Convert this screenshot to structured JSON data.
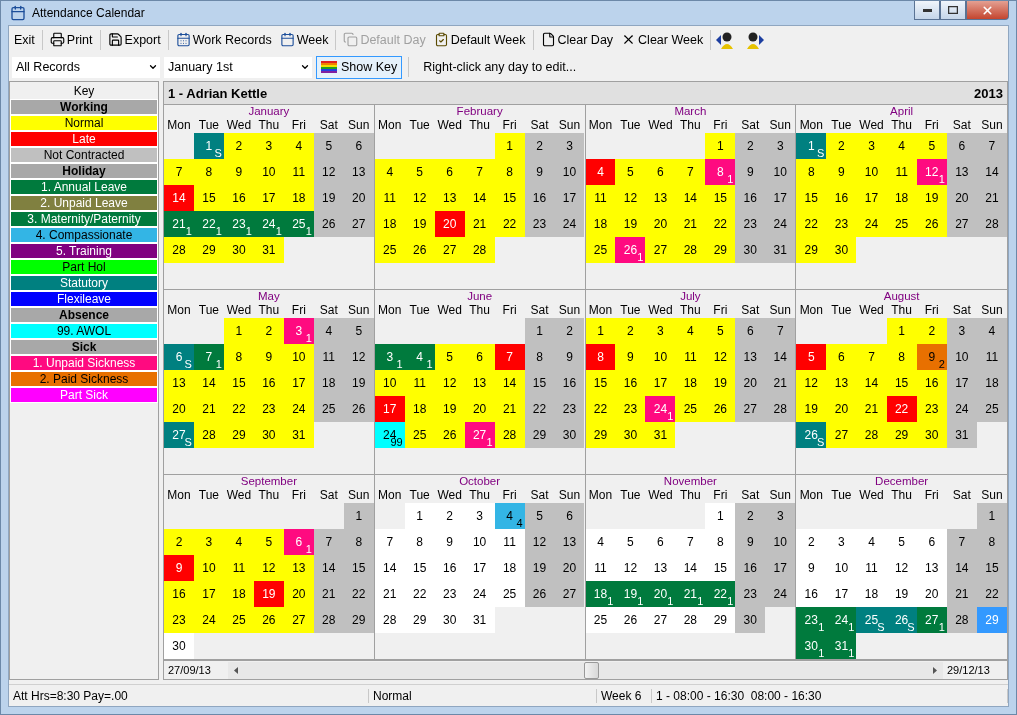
{
  "window": {
    "title": "Attendance Calendar"
  },
  "toolbar": [
    {
      "label": "Exit",
      "kind": "exit",
      "disabled": false
    },
    {
      "label": "Print",
      "kind": "print",
      "disabled": false
    },
    {
      "label": "Export",
      "kind": "export",
      "disabled": false
    },
    {
      "label": "Work Records",
      "kind": "records",
      "disabled": false
    },
    {
      "label": "Week",
      "kind": "week",
      "disabled": false
    },
    {
      "label": "Default Day",
      "kind": "default_day",
      "disabled": true
    },
    {
      "label": "Default Week",
      "kind": "default_week",
      "disabled": false
    },
    {
      "label": "Clear Day",
      "kind": "clear_day",
      "disabled": false
    },
    {
      "label": "Clear Week",
      "kind": "clear_week",
      "disabled": false
    }
  ],
  "filters": {
    "record": "All Records",
    "date": "January 1st"
  },
  "show_key": {
    "label": "Show Key",
    "pressed": true
  },
  "hint": "Right-click any day to edit...",
  "key": {
    "title": "Key",
    "items": [
      {
        "label": "Working",
        "kind": "group"
      },
      {
        "label": "Normal",
        "kind": "entry",
        "color": "#ffff00"
      },
      {
        "label": "Late",
        "kind": "entry",
        "color": "#ff0000"
      },
      {
        "label": "Not Contracted",
        "kind": "entry",
        "color": "#c0c0c0"
      },
      {
        "label": "Holiday",
        "kind": "group"
      },
      {
        "label": "1. Annual Leave",
        "kind": "entry",
        "color": "#007a3d"
      },
      {
        "label": "2. Unpaid Leave",
        "kind": "entry",
        "color": "#808040"
      },
      {
        "label": "3. Maternity/Paternity",
        "kind": "entry",
        "color": "#007a3d"
      },
      {
        "label": "4. Compassionate",
        "kind": "entry",
        "color": "#33b5e5"
      },
      {
        "label": "5. Training",
        "kind": "entry",
        "color": "#800080"
      },
      {
        "label": "Part Hol",
        "kind": "entry",
        "color": "#00ff00"
      },
      {
        "label": "Statutory",
        "kind": "entry",
        "color": "#008080"
      },
      {
        "label": "Flexileave",
        "kind": "entry",
        "color": "#0000ff"
      },
      {
        "label": "Absence",
        "kind": "group"
      },
      {
        "label": "99. AWOL",
        "kind": "entry",
        "color": "#00ffff"
      },
      {
        "label": "Sick",
        "kind": "group"
      },
      {
        "label": "1. Unpaid Sickness",
        "kind": "entry",
        "color": "#ff0a80"
      },
      {
        "label": "2. Paid Sickness",
        "kind": "entry",
        "color": "#e87000"
      },
      {
        "label": "Part Sick",
        "kind": "entry",
        "color": "#ff00ff"
      }
    ]
  },
  "calendar": {
    "employee": "1 - Adrian Kettle",
    "year": "2013",
    "months": [
      {
        "name": "January",
        "weekdays": [
          "Mon",
          "Tue",
          "Wed",
          "Thu",
          "Fri",
          "Sat",
          "Sun"
        ],
        "weeks": [
          [
            {
              "day": "1",
              "kind": "statutory",
              "note": "S"
            },
            {
              "day": "2",
              "kind": "work"
            },
            {
              "day": "3",
              "kind": "work"
            },
            {
              "day": "4",
              "kind": "work"
            },
            {
              "day": "5",
              "kind": "off"
            },
            {
              "day": "6",
              "kind": "off"
            }
          ],
          [
            {
              "day": "7",
              "kind": "work"
            },
            {
              "day": "8",
              "kind": "work"
            },
            {
              "day": "9",
              "kind": "work"
            },
            {
              "day": "10",
              "kind": "work"
            },
            {
              "day": "11",
              "kind": "work"
            },
            {
              "day": "12",
              "kind": "off"
            },
            {
              "day": "13",
              "kind": "off"
            }
          ],
          [
            {
              "day": "14",
              "kind": "late"
            },
            {
              "day": "15",
              "kind": "work"
            },
            {
              "day": "16",
              "kind": "work"
            },
            {
              "day": "17",
              "kind": "work"
            },
            {
              "day": "18",
              "kind": "work"
            },
            {
              "day": "19",
              "kind": "off"
            },
            {
              "day": "20",
              "kind": "off"
            }
          ],
          [
            {
              "day": "21",
              "kind": "annual",
              "note": "1"
            },
            {
              "day": "22",
              "kind": "annual",
              "note": "1"
            },
            {
              "day": "23",
              "kind": "annual",
              "note": "1"
            },
            {
              "day": "24",
              "kind": "annual",
              "note": "1"
            },
            {
              "day": "25",
              "kind": "annual",
              "note": "1"
            },
            {
              "day": "26",
              "kind": "off"
            },
            {
              "day": "27",
              "kind": "off"
            }
          ],
          [
            {
              "day": "28",
              "kind": "work"
            },
            {
              "day": "29",
              "kind": "work"
            },
            {
              "day": "30",
              "kind": "work"
            },
            {
              "day": "31",
              "kind": "work"
            }
          ]
        ]
      },
      {
        "name": "February",
        "weekdays": [
          "Mon",
          "Tue",
          "Wed",
          "Thu",
          "Fri",
          "Sat",
          "Sun"
        ],
        "weeks": [
          [
            {
              "day": "1",
              "kind": "work"
            },
            {
              "day": "2",
              "kind": "off"
            },
            {
              "day": "3",
              "kind": "off"
            }
          ],
          [
            {
              "day": "4",
              "kind": "work"
            },
            {
              "day": "5",
              "kind": "work"
            },
            {
              "day": "6",
              "kind": "work"
            },
            {
              "day": "7",
              "kind": "work"
            },
            {
              "day": "8",
              "kind": "work"
            },
            {
              "day": "9",
              "kind": "off"
            },
            {
              "day": "10",
              "kind": "off"
            }
          ],
          [
            {
              "day": "11",
              "kind": "work"
            },
            {
              "day": "12",
              "kind": "work"
            },
            {
              "day": "13",
              "kind": "work"
            },
            {
              "day": "14",
              "kind": "work"
            },
            {
              "day": "15",
              "kind": "work"
            },
            {
              "day": "16",
              "kind": "off"
            },
            {
              "day": "17",
              "kind": "off"
            }
          ],
          [
            {
              "day": "18",
              "kind": "work"
            },
            {
              "day": "19",
              "kind": "work"
            },
            {
              "day": "20",
              "kind": "late"
            },
            {
              "day": "21",
              "kind": "work"
            },
            {
              "day": "22",
              "kind": "work"
            },
            {
              "day": "23",
              "kind": "off"
            },
            {
              "day": "24",
              "kind": "off"
            }
          ],
          [
            {
              "day": "25",
              "kind": "work"
            },
            {
              "day": "26",
              "kind": "work"
            },
            {
              "day": "27",
              "kind": "work"
            },
            {
              "day": "28",
              "kind": "work"
            }
          ]
        ]
      },
      {
        "name": "March",
        "weekdays": [
          "Mon",
          "Tue",
          "Wed",
          "Thu",
          "Fri",
          "Sat",
          "Sun"
        ],
        "weeks": [
          [
            {
              "day": "1",
              "kind": "work"
            },
            {
              "day": "2",
              "kind": "off"
            },
            {
              "day": "3",
              "kind": "off"
            }
          ],
          [
            {
              "day": "4",
              "kind": "late"
            },
            {
              "day": "5",
              "kind": "work"
            },
            {
              "day": "6",
              "kind": "work"
            },
            {
              "day": "7",
              "kind": "work"
            },
            {
              "day": "8",
              "kind": "sick_unpaid",
              "note": "1"
            },
            {
              "day": "9",
              "kind": "off"
            },
            {
              "day": "10",
              "kind": "off"
            }
          ],
          [
            {
              "day": "11",
              "kind": "work"
            },
            {
              "day": "12",
              "kind": "work"
            },
            {
              "day": "13",
              "kind": "work"
            },
            {
              "day": "14",
              "kind": "work"
            },
            {
              "day": "15",
              "kind": "work"
            },
            {
              "day": "16",
              "kind": "off"
            },
            {
              "day": "17",
              "kind": "off"
            }
          ],
          [
            {
              "day": "18",
              "kind": "work"
            },
            {
              "day": "19",
              "kind": "work"
            },
            {
              "day": "20",
              "kind": "work"
            },
            {
              "day": "21",
              "kind": "work"
            },
            {
              "day": "22",
              "kind": "work"
            },
            {
              "day": "23",
              "kind": "off"
            },
            {
              "day": "24",
              "kind": "off"
            }
          ],
          [
            {
              "day": "25",
              "kind": "work"
            },
            {
              "day": "26",
              "kind": "sick_unpaid",
              "note": "1"
            },
            {
              "day": "27",
              "kind": "work"
            },
            {
              "day": "28",
              "kind": "work"
            },
            {
              "day": "29",
              "kind": "work"
            },
            {
              "day": "30",
              "kind": "off"
            },
            {
              "day": "31",
              "kind": "off"
            }
          ]
        ]
      },
      {
        "name": "April",
        "weekdays": [
          "Mon",
          "Tue",
          "Wed",
          "Thu",
          "Fri",
          "Sat",
          "Sun"
        ],
        "weeks": [
          [
            {
              "day": "1",
              "kind": "statutory",
              "note": "S"
            },
            {
              "day": "2",
              "kind": "work"
            },
            {
              "day": "3",
              "kind": "work"
            },
            {
              "day": "4",
              "kind": "work"
            },
            {
              "day": "5",
              "kind": "work"
            },
            {
              "day": "6",
              "kind": "off"
            },
            {
              "day": "7",
              "kind": "off"
            }
          ],
          [
            {
              "day": "8",
              "kind": "work"
            },
            {
              "day": "9",
              "kind": "work"
            },
            {
              "day": "10",
              "kind": "work"
            },
            {
              "day": "11",
              "kind": "work"
            },
            {
              "day": "12",
              "kind": "sick_unpaid",
              "note": "1"
            },
            {
              "day": "13",
              "kind": "off"
            },
            {
              "day": "14",
              "kind": "off"
            }
          ],
          [
            {
              "day": "15",
              "kind": "work"
            },
            {
              "day": "16",
              "kind": "work"
            },
            {
              "day": "17",
              "kind": "work"
            },
            {
              "day": "18",
              "kind": "work"
            },
            {
              "day": "19",
              "kind": "work"
            },
            {
              "day": "20",
              "kind": "off"
            },
            {
              "day": "21",
              "kind": "off"
            }
          ],
          [
            {
              "day": "22",
              "kind": "work"
            },
            {
              "day": "23",
              "kind": "work"
            },
            {
              "day": "24",
              "kind": "work"
            },
            {
              "day": "25",
              "kind": "work"
            },
            {
              "day": "26",
              "kind": "work"
            },
            {
              "day": "27",
              "kind": "off"
            },
            {
              "day": "28",
              "kind": "off"
            }
          ],
          [
            {
              "day": "29",
              "kind": "work"
            },
            {
              "day": "30",
              "kind": "work"
            }
          ]
        ]
      },
      {
        "name": "May",
        "weekdays": [
          "Mon",
          "Tue",
          "Wed",
          "Thu",
          "Fri",
          "Sat",
          "Sun"
        ],
        "weeks": [
          [
            {
              "day": "1",
              "kind": "work"
            },
            {
              "day": "2",
              "kind": "work"
            },
            {
              "day": "3",
              "kind": "sick_unpaid",
              "note": "1"
            },
            {
              "day": "4",
              "kind": "off"
            },
            {
              "day": "5",
              "kind": "off"
            }
          ],
          [
            {
              "day": "6",
              "kind": "statutory",
              "note": "S"
            },
            {
              "day": "7",
              "kind": "annual",
              "note": "1"
            },
            {
              "day": "8",
              "kind": "work"
            },
            {
              "day": "9",
              "kind": "work"
            },
            {
              "day": "10",
              "kind": "work"
            },
            {
              "day": "11",
              "kind": "off"
            },
            {
              "day": "12",
              "kind": "off"
            }
          ],
          [
            {
              "day": "13",
              "kind": "work"
            },
            {
              "day": "14",
              "kind": "work"
            },
            {
              "day": "15",
              "kind": "work"
            },
            {
              "day": "16",
              "kind": "work"
            },
            {
              "day": "17",
              "kind": "work"
            },
            {
              "day": "18",
              "kind": "off"
            },
            {
              "day": "19",
              "kind": "off"
            }
          ],
          [
            {
              "day": "20",
              "kind": "work"
            },
            {
              "day": "21",
              "kind": "work"
            },
            {
              "day": "22",
              "kind": "work"
            },
            {
              "day": "23",
              "kind": "work"
            },
            {
              "day": "24",
              "kind": "work"
            },
            {
              "day": "25",
              "kind": "off"
            },
            {
              "day": "26",
              "kind": "off"
            }
          ],
          [
            {
              "day": "27",
              "kind": "statutory",
              "note": "S"
            },
            {
              "day": "28",
              "kind": "work"
            },
            {
              "day": "29",
              "kind": "work"
            },
            {
              "day": "30",
              "kind": "work"
            },
            {
              "day": "31",
              "kind": "work"
            }
          ]
        ]
      },
      {
        "name": "June",
        "weekdays": [
          "Mon",
          "Tue",
          "Wed",
          "Thu",
          "Fri",
          "Sat",
          "Sun"
        ],
        "weeks": [
          [
            {
              "day": "1",
              "kind": "off"
            },
            {
              "day": "2",
              "kind": "off"
            }
          ],
          [
            {
              "day": "3",
              "kind": "annual",
              "note": "1"
            },
            {
              "day": "4",
              "kind": "annual",
              "note": "1"
            },
            {
              "day": "5",
              "kind": "work"
            },
            {
              "day": "6",
              "kind": "work"
            },
            {
              "day": "7",
              "kind": "late"
            },
            {
              "day": "8",
              "kind": "off"
            },
            {
              "day": "9",
              "kind": "off"
            }
          ],
          [
            {
              "day": "10",
              "kind": "work"
            },
            {
              "day": "11",
              "kind": "work"
            },
            {
              "day": "12",
              "kind": "work"
            },
            {
              "day": "13",
              "kind": "work"
            },
            {
              "day": "14",
              "kind": "work"
            },
            {
              "day": "15",
              "kind": "off"
            },
            {
              "day": "16",
              "kind": "off"
            }
          ],
          [
            {
              "day": "17",
              "kind": "late"
            },
            {
              "day": "18",
              "kind": "work"
            },
            {
              "day": "19",
              "kind": "work"
            },
            {
              "day": "20",
              "kind": "work"
            },
            {
              "day": "21",
              "kind": "work"
            },
            {
              "day": "22",
              "kind": "off"
            },
            {
              "day": "23",
              "kind": "off"
            }
          ],
          [
            {
              "day": "24",
              "kind": "awol",
              "note": "99"
            },
            {
              "day": "25",
              "kind": "work"
            },
            {
              "day": "26",
              "kind": "work"
            },
            {
              "day": "27",
              "kind": "sick_unpaid",
              "note": "1"
            },
            {
              "day": "28",
              "kind": "work"
            },
            {
              "day": "29",
              "kind": "off"
            },
            {
              "day": "30",
              "kind": "off"
            }
          ]
        ]
      },
      {
        "name": "July",
        "weekdays": [
          "Mon",
          "Tue",
          "Wed",
          "Thu",
          "Fri",
          "Sat",
          "Sun"
        ],
        "weeks": [
          [
            {
              "day": "1",
              "kind": "work"
            },
            {
              "day": "2",
              "kind": "work"
            },
            {
              "day": "3",
              "kind": "work"
            },
            {
              "day": "4",
              "kind": "work"
            },
            {
              "day": "5",
              "kind": "work"
            },
            {
              "day": "6",
              "kind": "off"
            },
            {
              "day": "7",
              "kind": "off"
            }
          ],
          [
            {
              "day": "8",
              "kind": "late"
            },
            {
              "day": "9",
              "kind": "work"
            },
            {
              "day": "10",
              "kind": "work"
            },
            {
              "day": "11",
              "kind": "work"
            },
            {
              "day": "12",
              "kind": "work"
            },
            {
              "day": "13",
              "kind": "off"
            },
            {
              "day": "14",
              "kind": "off"
            }
          ],
          [
            {
              "day": "15",
              "kind": "work"
            },
            {
              "day": "16",
              "kind": "work"
            },
            {
              "day": "17",
              "kind": "work"
            },
            {
              "day": "18",
              "kind": "work"
            },
            {
              "day": "19",
              "kind": "work"
            },
            {
              "day": "20",
              "kind": "off"
            },
            {
              "day": "21",
              "kind": "off"
            }
          ],
          [
            {
              "day": "22",
              "kind": "work"
            },
            {
              "day": "23",
              "kind": "work"
            },
            {
              "day": "24",
              "kind": "sick_unpaid",
              "note": "1"
            },
            {
              "day": "25",
              "kind": "work"
            },
            {
              "day": "26",
              "kind": "work"
            },
            {
              "day": "27",
              "kind": "off"
            },
            {
              "day": "28",
              "kind": "off"
            }
          ],
          [
            {
              "day": "29",
              "kind": "work"
            },
            {
              "day": "30",
              "kind": "work"
            },
            {
              "day": "31",
              "kind": "work"
            }
          ]
        ]
      },
      {
        "name": "August",
        "weekdays": [
          "Mon",
          "Tue",
          "Wed",
          "Thu",
          "Fri",
          "Sat",
          "Sun"
        ],
        "weeks": [
          [
            {
              "day": "1",
              "kind": "work"
            },
            {
              "day": "2",
              "kind": "work"
            },
            {
              "day": "3",
              "kind": "off"
            },
            {
              "day": "4",
              "kind": "off"
            }
          ],
          [
            {
              "day": "5",
              "kind": "late"
            },
            {
              "day": "6",
              "kind": "work"
            },
            {
              "day": "7",
              "kind": "work"
            },
            {
              "day": "8",
              "kind": "work"
            },
            {
              "day": "9",
              "kind": "sick_paid",
              "note": "2"
            },
            {
              "day": "10",
              "kind": "off"
            },
            {
              "day": "11",
              "kind": "off"
            }
          ],
          [
            {
              "day": "12",
              "kind": "work"
            },
            {
              "day": "13",
              "kind": "work"
            },
            {
              "day": "14",
              "kind": "work"
            },
            {
              "day": "15",
              "kind": "work"
            },
            {
              "day": "16",
              "kind": "work"
            },
            {
              "day": "17",
              "kind": "off"
            },
            {
              "day": "18",
              "kind": "off"
            }
          ],
          [
            {
              "day": "19",
              "kind": "work"
            },
            {
              "day": "20",
              "kind": "work"
            },
            {
              "day": "21",
              "kind": "work"
            },
            {
              "day": "22",
              "kind": "late"
            },
            {
              "day": "23",
              "kind": "work"
            },
            {
              "day": "24",
              "kind": "off"
            },
            {
              "day": "25",
              "kind": "off"
            }
          ],
          [
            {
              "day": "26",
              "kind": "statutory",
              "note": "S"
            },
            {
              "day": "27",
              "kind": "work"
            },
            {
              "day": "28",
              "kind": "work"
            },
            {
              "day": "29",
              "kind": "work"
            },
            {
              "day": "30",
              "kind": "work"
            },
            {
              "day": "31",
              "kind": "off"
            }
          ]
        ]
      },
      {
        "name": "September",
        "weekdays": [
          "Mon",
          "Tue",
          "Wed",
          "Thu",
          "Fri",
          "Sat",
          "Sun"
        ],
        "weeks": [
          [
            {
              "day": "1",
              "kind": "off"
            }
          ],
          [
            {
              "day": "2",
              "kind": "work"
            },
            {
              "day": "3",
              "kind": "work"
            },
            {
              "day": "4",
              "kind": "work"
            },
            {
              "day": "5",
              "kind": "work"
            },
            {
              "day": "6",
              "kind": "sick_unpaid",
              "note": "1"
            },
            {
              "day": "7",
              "kind": "off"
            },
            {
              "day": "8",
              "kind": "off"
            }
          ],
          [
            {
              "day": "9",
              "kind": "late"
            },
            {
              "day": "10",
              "kind": "work"
            },
            {
              "day": "11",
              "kind": "work"
            },
            {
              "day": "12",
              "kind": "work"
            },
            {
              "day": "13",
              "kind": "work"
            },
            {
              "day": "14",
              "kind": "off"
            },
            {
              "day": "15",
              "kind": "off"
            }
          ],
          [
            {
              "day": "16",
              "kind": "work"
            },
            {
              "day": "17",
              "kind": "work"
            },
            {
              "day": "18",
              "kind": "work"
            },
            {
              "day": "19",
              "kind": "late"
            },
            {
              "day": "20",
              "kind": "work"
            },
            {
              "day": "21",
              "kind": "off"
            },
            {
              "day": "22",
              "kind": "off"
            }
          ],
          [
            {
              "day": "23",
              "kind": "work"
            },
            {
              "day": "24",
              "kind": "work"
            },
            {
              "day": "25",
              "kind": "work"
            },
            {
              "day": "26",
              "kind": "work"
            },
            {
              "day": "27",
              "kind": "work"
            },
            {
              "day": "28",
              "kind": "off"
            },
            {
              "day": "29",
              "kind": "off"
            }
          ],
          [
            {
              "day": "30",
              "kind": "blank"
            }
          ]
        ]
      },
      {
        "name": "October",
        "weekdays": [
          "Mon",
          "Tue",
          "Wed",
          "Thu",
          "Fri",
          "Sat",
          "Sun"
        ],
        "weeks": [
          [
            {
              "day": "1",
              "kind": "blank"
            },
            {
              "day": "2",
              "kind": "blank"
            },
            {
              "day": "3",
              "kind": "blank"
            },
            {
              "day": "4",
              "kind": "compassionate",
              "note": "4"
            },
            {
              "day": "5",
              "kind": "off"
            },
            {
              "day": "6",
              "kind": "off"
            }
          ],
          [
            {
              "day": "7",
              "kind": "blank"
            },
            {
              "day": "8",
              "kind": "blank"
            },
            {
              "day": "9",
              "kind": "blank"
            },
            {
              "day": "10",
              "kind": "blank"
            },
            {
              "day": "11",
              "kind": "blank"
            },
            {
              "day": "12",
              "kind": "off"
            },
            {
              "day": "13",
              "kind": "off"
            }
          ],
          [
            {
              "day": "14",
              "kind": "blank"
            },
            {
              "day": "15",
              "kind": "blank"
            },
            {
              "day": "16",
              "kind": "blank"
            },
            {
              "day": "17",
              "kind": "blank"
            },
            {
              "day": "18",
              "kind": "blank"
            },
            {
              "day": "19",
              "kind": "off"
            },
            {
              "day": "20",
              "kind": "off"
            }
          ],
          [
            {
              "day": "21",
              "kind": "blank"
            },
            {
              "day": "22",
              "kind": "blank"
            },
            {
              "day": "23",
              "kind": "blank"
            },
            {
              "day": "24",
              "kind": "blank"
            },
            {
              "day": "25",
              "kind": "blank"
            },
            {
              "day": "26",
              "kind": "off"
            },
            {
              "day": "27",
              "kind": "off"
            }
          ],
          [
            {
              "day": "28",
              "kind": "blank"
            },
            {
              "day": "29",
              "kind": "blank"
            },
            {
              "day": "30",
              "kind": "blank"
            },
            {
              "day": "31",
              "kind": "blank"
            }
          ]
        ]
      },
      {
        "name": "November",
        "weekdays": [
          "Mon",
          "Tue",
          "Wed",
          "Thu",
          "Fri",
          "Sat",
          "Sun"
        ],
        "weeks": [
          [
            {
              "day": "1",
              "kind": "blank"
            },
            {
              "day": "2",
              "kind": "off"
            },
            {
              "day": "3",
              "kind": "off"
            }
          ],
          [
            {
              "day": "4",
              "kind": "blank"
            },
            {
              "day": "5",
              "kind": "blank"
            },
            {
              "day": "6",
              "kind": "blank"
            },
            {
              "day": "7",
              "kind": "blank"
            },
            {
              "day": "8",
              "kind": "blank"
            },
            {
              "day": "9",
              "kind": "off"
            },
            {
              "day": "10",
              "kind": "off"
            }
          ],
          [
            {
              "day": "11",
              "kind": "blank"
            },
            {
              "day": "12",
              "kind": "blank"
            },
            {
              "day": "13",
              "kind": "blank"
            },
            {
              "day": "14",
              "kind": "blank"
            },
            {
              "day": "15",
              "kind": "blank"
            },
            {
              "day": "16",
              "kind": "off"
            },
            {
              "day": "17",
              "kind": "off"
            }
          ],
          [
            {
              "day": "18",
              "kind": "annual",
              "note": "1"
            },
            {
              "day": "19",
              "kind": "annual",
              "note": "1"
            },
            {
              "day": "20",
              "kind": "annual",
              "note": "1"
            },
            {
              "day": "21",
              "kind": "annual",
              "note": "1"
            },
            {
              "day": "22",
              "kind": "annual",
              "note": "1"
            },
            {
              "day": "23",
              "kind": "off"
            },
            {
              "day": "24",
              "kind": "off"
            }
          ],
          [
            {
              "day": "25",
              "kind": "blank"
            },
            {
              "day": "26",
              "kind": "blank"
            },
            {
              "day": "27",
              "kind": "blank"
            },
            {
              "day": "28",
              "kind": "blank"
            },
            {
              "day": "29",
              "kind": "blank"
            },
            {
              "day": "30",
              "kind": "off"
            }
          ]
        ]
      },
      {
        "name": "December",
        "weekdays": [
          "Mon",
          "Tue",
          "Wed",
          "Thu",
          "Fri",
          "Sat",
          "Sun"
        ],
        "weeks": [
          [
            {
              "day": "1",
              "kind": "off"
            }
          ],
          [
            {
              "day": "2",
              "kind": "blank"
            },
            {
              "day": "3",
              "kind": "blank"
            },
            {
              "day": "4",
              "kind": "blank"
            },
            {
              "day": "5",
              "kind": "blank"
            },
            {
              "day": "6",
              "kind": "blank"
            },
            {
              "day": "7",
              "kind": "off"
            },
            {
              "day": "8",
              "kind": "off"
            }
          ],
          [
            {
              "day": "9",
              "kind": "blank"
            },
            {
              "day": "10",
              "kind": "blank"
            },
            {
              "day": "11",
              "kind": "blank"
            },
            {
              "day": "12",
              "kind": "blank"
            },
            {
              "day": "13",
              "kind": "blank"
            },
            {
              "day": "14",
              "kind": "off"
            },
            {
              "day": "15",
              "kind": "off"
            }
          ],
          [
            {
              "day": "16",
              "kind": "blank"
            },
            {
              "day": "17",
              "kind": "blank"
            },
            {
              "day": "18",
              "kind": "blank"
            },
            {
              "day": "19",
              "kind": "blank"
            },
            {
              "day": "20",
              "kind": "blank"
            },
            {
              "day": "21",
              "kind": "off"
            },
            {
              "day": "22",
              "kind": "off"
            }
          ],
          [
            {
              "day": "23",
              "kind": "annual",
              "note": "1"
            },
            {
              "day": "24",
              "kind": "annual",
              "note": "1"
            },
            {
              "day": "25",
              "kind": "statutory",
              "note": "S"
            },
            {
              "day": "26",
              "kind": "statutory",
              "note": "S"
            },
            {
              "day": "27",
              "kind": "annual",
              "note": "1"
            },
            {
              "day": "28",
              "kind": "off"
            },
            {
              "day": "29",
              "kind": "today"
            }
          ],
          [
            {
              "day": "30",
              "kind": "annual",
              "note": "1"
            },
            {
              "day": "31",
              "kind": "annual",
              "note": "1"
            }
          ]
        ]
      }
    ]
  },
  "scroll": {
    "start": "27/09/13",
    "end": "29/12/13"
  },
  "status_bar": [
    "Att Hrs=8:30 Pay=.00",
    "Normal",
    "Week 6",
    "1 - 08:00 - 16:30  08:00 - 16:30"
  ]
}
